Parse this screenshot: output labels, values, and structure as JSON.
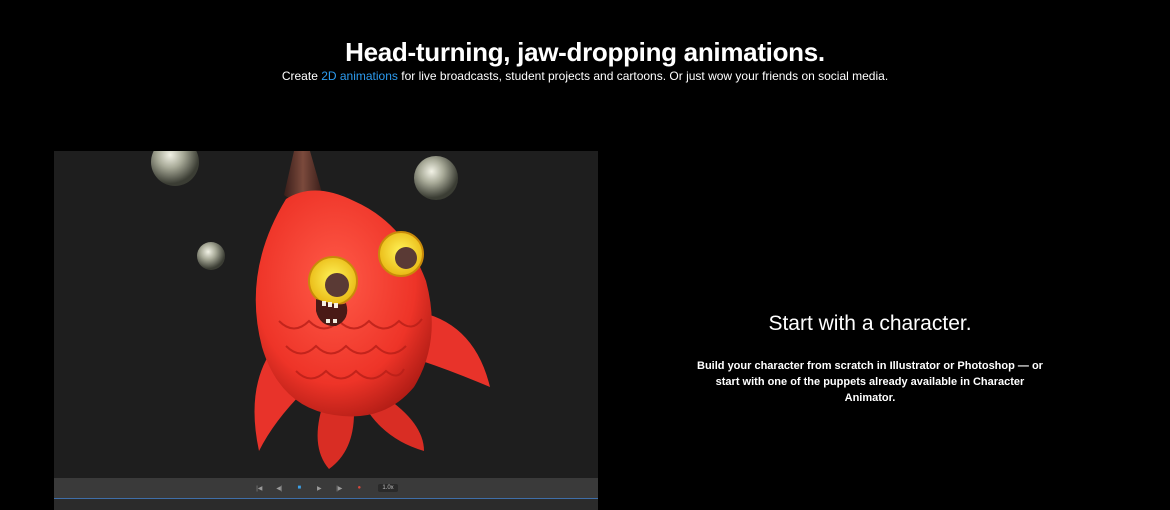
{
  "hero": {
    "title": "Head-turning, jaw-dropping animations.",
    "subtitle_prefix": "Create ",
    "subtitle_link": "2D animations",
    "subtitle_suffix": " for live broadcasts, student projects and cartoons. Or just wow your friends on social media."
  },
  "viewer": {
    "transport": {
      "buttons": [
        {
          "name": "skip-to-start-button",
          "glyph": "|◀"
        },
        {
          "name": "step-back-button",
          "glyph": "◀|"
        },
        {
          "name": "stop-button",
          "glyph": "■"
        },
        {
          "name": "play-button",
          "glyph": "▶"
        },
        {
          "name": "step-forward-button",
          "glyph": "|▶"
        },
        {
          "name": "record-button",
          "glyph": "●"
        }
      ],
      "speed": "1.0x"
    }
  },
  "feature": {
    "title": "Start with a character.",
    "body": "Build your character from scratch in Illustrator or Photoshop — or start with one of the puppets already available in Character Animator."
  },
  "colors": {
    "background": "#000000",
    "link": "#2d9cf0",
    "stage": "#1e1e1e",
    "character_red": "#f2392f"
  }
}
